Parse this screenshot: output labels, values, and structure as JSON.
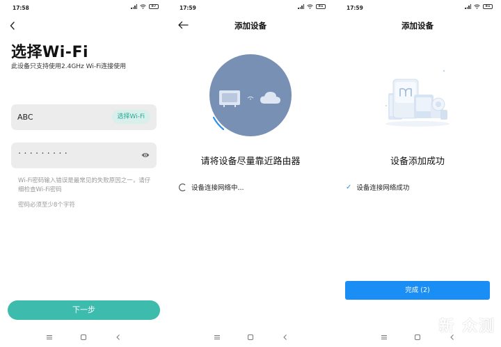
{
  "screens": [
    {
      "status": {
        "time": "17:58",
        "battery": "87"
      },
      "title": "选择Wi-Fi",
      "subtitle": "此设备只支持使用2.4GHz Wi-Fi连接使用",
      "ssid": {
        "value": "ABC",
        "pick_label": "选择Wi-Fi"
      },
      "password": {
        "masked": "·········"
      },
      "hints": [
        "Wi-Fi密码输入错误是最常见的失败原因之一，请仔细检查Wi-Fi密码",
        "密码必须至少8个字符"
      ],
      "next_label": "下一步"
    },
    {
      "status": {
        "time": "17:59",
        "battery": "81"
      },
      "title": "添加设备",
      "instruction": "请将设备尽量靠近路由器",
      "progress_text": "设备连接网络中..."
    },
    {
      "status": {
        "time": "17:59",
        "battery": "81"
      },
      "title": "添加设备",
      "result_text": "设备添加成功",
      "done_item": "设备连接网络成功",
      "done_label": "完成 (2)"
    }
  ],
  "watermark": "新 众测",
  "colors": {
    "teal_accent": "#3dbbad",
    "blue_accent": "#1a8ef5",
    "circle": "#7790b4",
    "check": "#2b8ee8"
  },
  "icons": [
    "back-arrow-icon",
    "eye-icon",
    "signal-icon",
    "wifi-icon",
    "battery-icon",
    "menu-icon",
    "home-icon",
    "back-nav-icon",
    "check-icon",
    "spinner-icon"
  ]
}
